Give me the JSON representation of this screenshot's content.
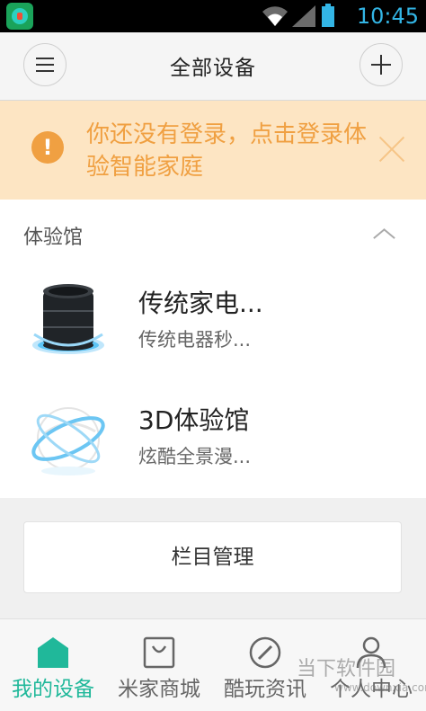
{
  "status_bar": {
    "time": "10:45",
    "accent_color": "#33b5e5"
  },
  "header": {
    "title": "全部设备",
    "menu_icon": "hamburger-icon",
    "add_icon": "plus-icon"
  },
  "banner": {
    "message": "你还没有登录，点击登录体验智能家庭",
    "background_color": "#fde5c3",
    "text_color": "#f0a042",
    "icon": "warning-icon",
    "close_icon": "close-icon"
  },
  "section": {
    "title": "体验馆",
    "toggle_icon": "chevron-up-icon",
    "items": [
      {
        "title": "传统家电...",
        "subtitle": "传统电器秒...",
        "icon": "speaker-icon"
      },
      {
        "title": "3D体验馆",
        "subtitle": "炫酷全景漫...",
        "icon": "sphere-icon"
      }
    ]
  },
  "manage_button": {
    "label": "栏目管理"
  },
  "tabs": [
    {
      "label": "我的设备",
      "icon": "home-icon",
      "active": true
    },
    {
      "label": "米家商城",
      "icon": "shopping-bag-icon",
      "active": false
    },
    {
      "label": "酷玩资讯",
      "icon": "compass-icon",
      "active": false
    },
    {
      "label": "个人中心",
      "icon": "person-icon",
      "active": false
    }
  ],
  "watermark": {
    "text": "当下软件园",
    "url": "www.downxia.com"
  },
  "colors": {
    "brand": "#20b89a"
  }
}
